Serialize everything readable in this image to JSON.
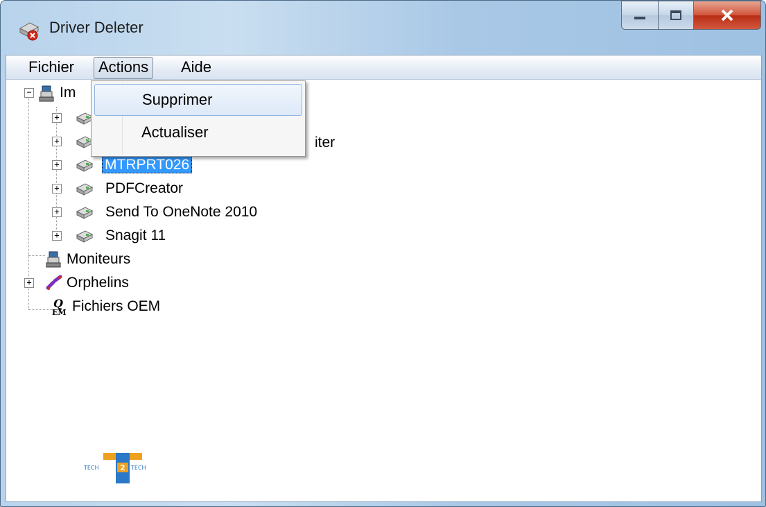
{
  "window": {
    "title": "Driver Deleter"
  },
  "menubar": {
    "items": [
      "Fichier",
      "Actions",
      "Aide"
    ]
  },
  "actions_menu": {
    "items": [
      "Supprimer",
      "Actualiser"
    ]
  },
  "tree": {
    "root_printers_label": "Im",
    "printers": [
      "",
      "iter",
      "MTRPRT026",
      "PDFCreator",
      "Send To OneNote 2010",
      "Snagit 11"
    ],
    "selected": "MTRPRT026",
    "monitors": "Moniteurs",
    "orphans": "Orphelins",
    "oem": "Fichiers OEM"
  },
  "logo": {
    "left": "TECH",
    "mid": "2",
    "right": "TECH"
  },
  "colors": {
    "selection": "#3399ff",
    "close_button": "#c9452a",
    "titlebar": "#b8d3ec"
  }
}
